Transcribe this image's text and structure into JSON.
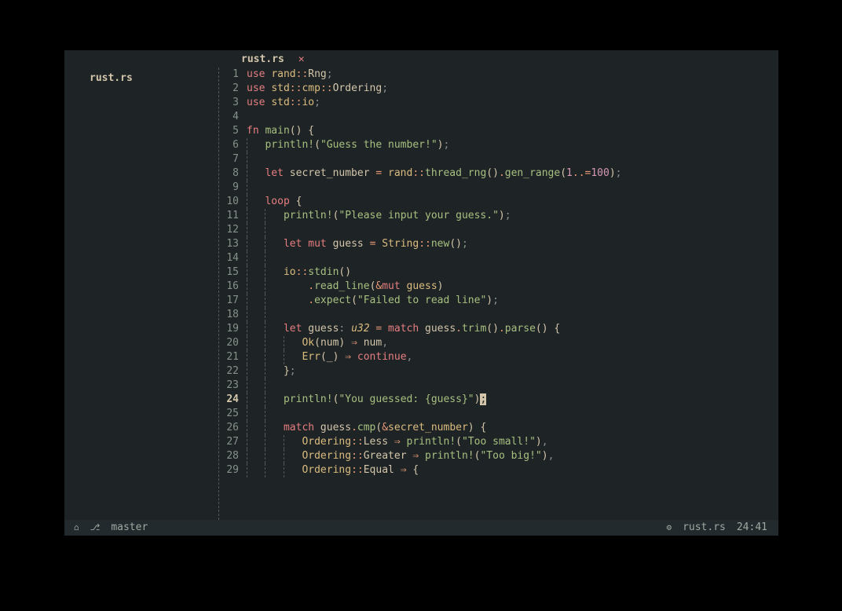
{
  "tab": {
    "name": "rust.rs",
    "close": "✕"
  },
  "sidebar": {
    "file": "rust.rs"
  },
  "current_line": 24,
  "status": {
    "home_icon": "⌂",
    "branch_icon": "⎇",
    "branch": "master",
    "gear_icon": "⚙",
    "filename": "rust.rs",
    "position": "24:41"
  },
  "lines": [
    [
      {
        "c": "kw",
        "t": "use"
      },
      {
        "c": "var",
        "t": " "
      },
      {
        "c": "ty",
        "t": "rand"
      },
      {
        "c": "op",
        "t": "::"
      },
      {
        "c": "var",
        "t": "Rng"
      },
      {
        "c": "pun",
        "t": ";"
      }
    ],
    [
      {
        "c": "kw",
        "t": "use"
      },
      {
        "c": "var",
        "t": " "
      },
      {
        "c": "ty",
        "t": "std"
      },
      {
        "c": "op",
        "t": "::"
      },
      {
        "c": "ty",
        "t": "cmp"
      },
      {
        "c": "op",
        "t": "::"
      },
      {
        "c": "var",
        "t": "Ordering"
      },
      {
        "c": "pun",
        "t": ";"
      }
    ],
    [
      {
        "c": "kw",
        "t": "use"
      },
      {
        "c": "var",
        "t": " "
      },
      {
        "c": "ty",
        "t": "std"
      },
      {
        "c": "op",
        "t": "::"
      },
      {
        "c": "ty",
        "t": "io"
      },
      {
        "c": "pun",
        "t": ";"
      }
    ],
    [],
    [
      {
        "c": "kw",
        "t": "fn"
      },
      {
        "c": "var",
        "t": " "
      },
      {
        "c": "fn",
        "t": "main"
      },
      {
        "c": "par",
        "t": "()"
      },
      {
        "c": "var",
        "t": " "
      },
      {
        "c": "par",
        "t": "{"
      }
    ],
    [
      {
        "indent": 1
      },
      {
        "c": "var",
        "t": "   "
      },
      {
        "c": "mc",
        "t": "println!"
      },
      {
        "c": "par",
        "t": "("
      },
      {
        "c": "str",
        "t": "\"Guess the number!\""
      },
      {
        "c": "par",
        "t": ")"
      },
      {
        "c": "pun",
        "t": ";"
      }
    ],
    [
      {
        "indent": 1
      }
    ],
    [
      {
        "indent": 1
      },
      {
        "c": "var",
        "t": "   "
      },
      {
        "c": "kw",
        "t": "let"
      },
      {
        "c": "var",
        "t": " secret_number "
      },
      {
        "c": "op",
        "t": "="
      },
      {
        "c": "var",
        "t": " "
      },
      {
        "c": "ty",
        "t": "rand"
      },
      {
        "c": "op",
        "t": "::"
      },
      {
        "c": "fn",
        "t": "thread_rng"
      },
      {
        "c": "par",
        "t": "()"
      },
      {
        "c": "op",
        "t": "."
      },
      {
        "c": "fn",
        "t": "gen_range"
      },
      {
        "c": "par",
        "t": "("
      },
      {
        "c": "num",
        "t": "1"
      },
      {
        "c": "op",
        "t": "..="
      },
      {
        "c": "num",
        "t": "100"
      },
      {
        "c": "par",
        "t": ")"
      },
      {
        "c": "pun",
        "t": ";"
      }
    ],
    [
      {
        "indent": 1
      }
    ],
    [
      {
        "indent": 1
      },
      {
        "c": "var",
        "t": "   "
      },
      {
        "c": "kw",
        "t": "loop"
      },
      {
        "c": "var",
        "t": " "
      },
      {
        "c": "par",
        "t": "{"
      }
    ],
    [
      {
        "indent": 1
      },
      {
        "c": "var",
        "t": "   "
      },
      {
        "indent": 1
      },
      {
        "c": "var",
        "t": "   "
      },
      {
        "c": "mc",
        "t": "println!"
      },
      {
        "c": "par",
        "t": "("
      },
      {
        "c": "str",
        "t": "\"Please input your guess.\""
      },
      {
        "c": "par",
        "t": ")"
      },
      {
        "c": "pun",
        "t": ";"
      }
    ],
    [
      {
        "indent": 1
      },
      {
        "c": "var",
        "t": "   "
      },
      {
        "indent": 1
      }
    ],
    [
      {
        "indent": 1
      },
      {
        "c": "var",
        "t": "   "
      },
      {
        "indent": 1
      },
      {
        "c": "var",
        "t": "   "
      },
      {
        "c": "kw",
        "t": "let"
      },
      {
        "c": "var",
        "t": " "
      },
      {
        "c": "kw",
        "t": "mut"
      },
      {
        "c": "var",
        "t": " guess "
      },
      {
        "c": "op",
        "t": "="
      },
      {
        "c": "var",
        "t": " "
      },
      {
        "c": "ty",
        "t": "String"
      },
      {
        "c": "op",
        "t": "::"
      },
      {
        "c": "fn",
        "t": "new"
      },
      {
        "c": "par",
        "t": "()"
      },
      {
        "c": "pun",
        "t": ";"
      }
    ],
    [
      {
        "indent": 1
      },
      {
        "c": "var",
        "t": "   "
      },
      {
        "indent": 1
      }
    ],
    [
      {
        "indent": 1
      },
      {
        "c": "var",
        "t": "   "
      },
      {
        "indent": 1
      },
      {
        "c": "var",
        "t": "   "
      },
      {
        "c": "ty",
        "t": "io"
      },
      {
        "c": "op",
        "t": "::"
      },
      {
        "c": "fn",
        "t": "stdin"
      },
      {
        "c": "par",
        "t": "()"
      }
    ],
    [
      {
        "indent": 1
      },
      {
        "c": "var",
        "t": "   "
      },
      {
        "indent": 1
      },
      {
        "c": "var",
        "t": "       "
      },
      {
        "c": "op",
        "t": "."
      },
      {
        "c": "fn",
        "t": "read_line"
      },
      {
        "c": "par",
        "t": "("
      },
      {
        "c": "op",
        "t": "&"
      },
      {
        "c": "kw",
        "t": "mut"
      },
      {
        "c": "var",
        "t": " "
      },
      {
        "c": "ty",
        "t": "guess"
      },
      {
        "c": "par",
        "t": ")"
      }
    ],
    [
      {
        "indent": 1
      },
      {
        "c": "var",
        "t": "   "
      },
      {
        "indent": 1
      },
      {
        "c": "var",
        "t": "       "
      },
      {
        "c": "op",
        "t": "."
      },
      {
        "c": "fn",
        "t": "expect"
      },
      {
        "c": "par",
        "t": "("
      },
      {
        "c": "str",
        "t": "\"Failed to read line\""
      },
      {
        "c": "par",
        "t": ")"
      },
      {
        "c": "pun",
        "t": ";"
      }
    ],
    [
      {
        "indent": 1
      },
      {
        "c": "var",
        "t": "   "
      },
      {
        "indent": 1
      }
    ],
    [
      {
        "indent": 1
      },
      {
        "c": "var",
        "t": "   "
      },
      {
        "indent": 1
      },
      {
        "c": "var",
        "t": "   "
      },
      {
        "c": "kw",
        "t": "let"
      },
      {
        "c": "var",
        "t": " guess"
      },
      {
        "c": "pun",
        "t": ":"
      },
      {
        "c": "var",
        "t": " "
      },
      {
        "c": "ty ital",
        "t": "u32"
      },
      {
        "c": "var",
        "t": " "
      },
      {
        "c": "op",
        "t": "="
      },
      {
        "c": "var",
        "t": " "
      },
      {
        "c": "kw",
        "t": "match"
      },
      {
        "c": "var",
        "t": " guess"
      },
      {
        "c": "op",
        "t": "."
      },
      {
        "c": "fn",
        "t": "trim"
      },
      {
        "c": "par",
        "t": "()"
      },
      {
        "c": "op",
        "t": "."
      },
      {
        "c": "fn",
        "t": "parse"
      },
      {
        "c": "par",
        "t": "()"
      },
      {
        "c": "var",
        "t": " "
      },
      {
        "c": "par",
        "t": "{"
      }
    ],
    [
      {
        "indent": 1
      },
      {
        "c": "var",
        "t": "   "
      },
      {
        "indent": 1
      },
      {
        "c": "var",
        "t": "   "
      },
      {
        "indent": 1
      },
      {
        "c": "var",
        "t": "   "
      },
      {
        "c": "ty",
        "t": "Ok"
      },
      {
        "c": "par",
        "t": "("
      },
      {
        "c": "var",
        "t": "num"
      },
      {
        "c": "par",
        "t": ")"
      },
      {
        "c": "var",
        "t": " "
      },
      {
        "c": "op",
        "t": "⇒"
      },
      {
        "c": "var",
        "t": " num"
      },
      {
        "c": "pun",
        "t": ","
      }
    ],
    [
      {
        "indent": 1
      },
      {
        "c": "var",
        "t": "   "
      },
      {
        "indent": 1
      },
      {
        "c": "var",
        "t": "   "
      },
      {
        "indent": 1
      },
      {
        "c": "var",
        "t": "   "
      },
      {
        "c": "ty",
        "t": "Err"
      },
      {
        "c": "par",
        "t": "("
      },
      {
        "c": "var",
        "t": "_"
      },
      {
        "c": "par",
        "t": ")"
      },
      {
        "c": "var",
        "t": " "
      },
      {
        "c": "op",
        "t": "⇒"
      },
      {
        "c": "var",
        "t": " "
      },
      {
        "c": "kw",
        "t": "continue"
      },
      {
        "c": "pun",
        "t": ","
      }
    ],
    [
      {
        "indent": 1
      },
      {
        "c": "var",
        "t": "   "
      },
      {
        "indent": 1
      },
      {
        "c": "var",
        "t": "   "
      },
      {
        "c": "par",
        "t": "}"
      },
      {
        "c": "pun",
        "t": ";"
      }
    ],
    [
      {
        "indent": 1
      },
      {
        "c": "var",
        "t": "   "
      },
      {
        "indent": 1
      }
    ],
    [
      {
        "indent": 1
      },
      {
        "c": "var",
        "t": "   "
      },
      {
        "indent": 1
      },
      {
        "c": "var",
        "t": "   "
      },
      {
        "c": "mc",
        "t": "println!"
      },
      {
        "c": "par",
        "t": "("
      },
      {
        "c": "str",
        "t": "\"You guessed: {guess}\""
      },
      {
        "c": "par",
        "t": ")"
      },
      {
        "c": "cursor",
        "t": ";"
      }
    ],
    [
      {
        "indent": 1
      },
      {
        "c": "var",
        "t": "   "
      },
      {
        "indent": 1
      }
    ],
    [
      {
        "indent": 1
      },
      {
        "c": "var",
        "t": "   "
      },
      {
        "indent": 1
      },
      {
        "c": "var",
        "t": "   "
      },
      {
        "c": "kw",
        "t": "match"
      },
      {
        "c": "var",
        "t": " guess"
      },
      {
        "c": "op",
        "t": "."
      },
      {
        "c": "fn",
        "t": "cmp"
      },
      {
        "c": "par",
        "t": "("
      },
      {
        "c": "op",
        "t": "&"
      },
      {
        "c": "ty",
        "t": "secret_number"
      },
      {
        "c": "par",
        "t": ")"
      },
      {
        "c": "var",
        "t": " "
      },
      {
        "c": "par",
        "t": "{"
      }
    ],
    [
      {
        "indent": 1
      },
      {
        "c": "var",
        "t": "   "
      },
      {
        "indent": 1
      },
      {
        "c": "var",
        "t": "   "
      },
      {
        "indent": 1
      },
      {
        "c": "var",
        "t": "   "
      },
      {
        "c": "ty",
        "t": "Ordering"
      },
      {
        "c": "op",
        "t": "::"
      },
      {
        "c": "enumv",
        "t": "Less"
      },
      {
        "c": "var",
        "t": " "
      },
      {
        "c": "op",
        "t": "⇒"
      },
      {
        "c": "var",
        "t": " "
      },
      {
        "c": "mc",
        "t": "println!"
      },
      {
        "c": "par",
        "t": "("
      },
      {
        "c": "str",
        "t": "\"Too small!\""
      },
      {
        "c": "par",
        "t": ")"
      },
      {
        "c": "pun",
        "t": ","
      }
    ],
    [
      {
        "indent": 1
      },
      {
        "c": "var",
        "t": "   "
      },
      {
        "indent": 1
      },
      {
        "c": "var",
        "t": "   "
      },
      {
        "indent": 1
      },
      {
        "c": "var",
        "t": "   "
      },
      {
        "c": "ty",
        "t": "Ordering"
      },
      {
        "c": "op",
        "t": "::"
      },
      {
        "c": "enumv",
        "t": "Greater"
      },
      {
        "c": "var",
        "t": " "
      },
      {
        "c": "op",
        "t": "⇒"
      },
      {
        "c": "var",
        "t": " "
      },
      {
        "c": "mc",
        "t": "println!"
      },
      {
        "c": "par",
        "t": "("
      },
      {
        "c": "str",
        "t": "\"Too big!\""
      },
      {
        "c": "par",
        "t": ")"
      },
      {
        "c": "pun",
        "t": ","
      }
    ],
    [
      {
        "indent": 1
      },
      {
        "c": "var",
        "t": "   "
      },
      {
        "indent": 1
      },
      {
        "c": "var",
        "t": "   "
      },
      {
        "indent": 1
      },
      {
        "c": "var",
        "t": "   "
      },
      {
        "c": "ty",
        "t": "Ordering"
      },
      {
        "c": "op",
        "t": "::"
      },
      {
        "c": "enumv",
        "t": "Equal"
      },
      {
        "c": "var",
        "t": " "
      },
      {
        "c": "op",
        "t": "⇒"
      },
      {
        "c": "var",
        "t": " "
      },
      {
        "c": "par",
        "t": "{"
      }
    ]
  ]
}
